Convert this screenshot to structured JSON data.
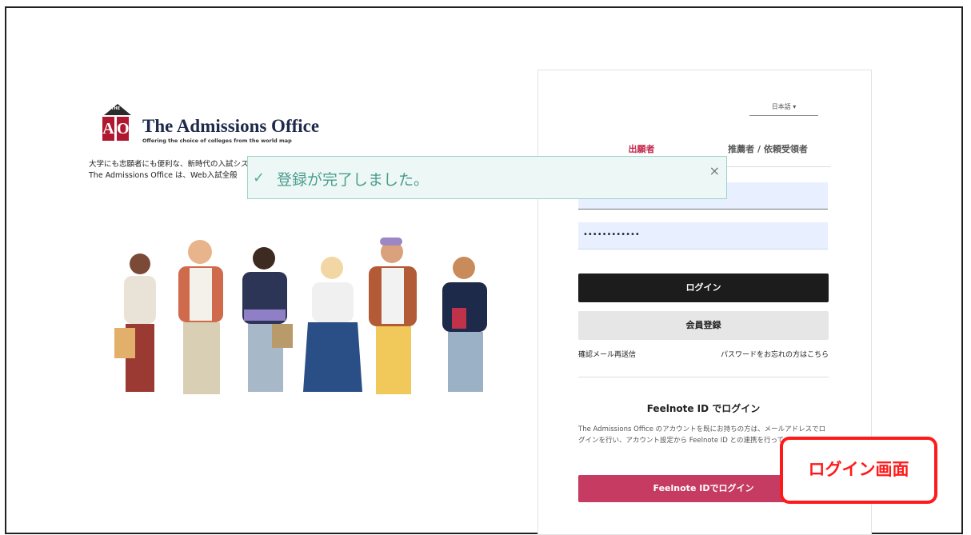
{
  "brand": {
    "the": "THE",
    "a": "A",
    "o": "O",
    "name": "The Admissions Office",
    "tagline": "Offering the choice of colleges from the world map",
    "lead_line1": "大学にも志願者にも便利な、新時代の入試システム",
    "lead_line2": "The Admissions Office は、Web入試全般"
  },
  "login": {
    "language": "日本語",
    "tabs": [
      {
        "label": "出願者",
        "active": true
      },
      {
        "label": "推薦者 / 依頼受領者",
        "active": false
      }
    ],
    "id_value": "",
    "password_value": "••••••••••••",
    "login_button": "ログイン",
    "register_button": "会員登録",
    "resend_link": "確認メール再送信",
    "forgot_link": "パスワードをお忘れの方はこちら",
    "feelnote_title": "Feelnote ID でログイン",
    "feelnote_desc": "The Admissions Office のアカウントを既にお持ちの方は、メールアドレスでログインを行い、アカウント設定から Feelnote ID との連携を行ってください。",
    "feelnote_button": "Feelnote IDでログイン"
  },
  "toast": {
    "check": "✓",
    "message": "登録が完了しました。",
    "close": "×"
  },
  "annotation": {
    "label": "ログイン画面"
  },
  "colors": {
    "brand_red": "#b0182f",
    "tab_active": "#c0254a",
    "feelnote": "#c53b62",
    "toast_text": "#4b9c8f",
    "callout": "#ff1a1a"
  }
}
